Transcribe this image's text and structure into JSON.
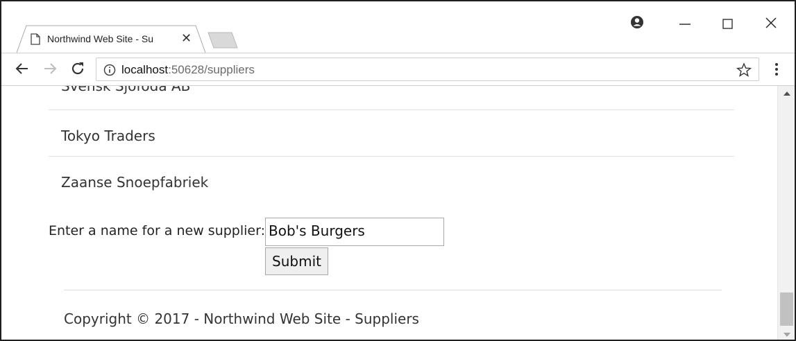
{
  "browser": {
    "tab": {
      "title": "Northwind Web Site - Su",
      "close_glyph": "✕",
      "page_icon": "page-icon"
    },
    "window_controls": {
      "minimize_glyph": "—",
      "maximize_glyph": "☐",
      "close_glyph": "✕"
    },
    "address_bar": {
      "host": "localhost",
      "rest": ":50628/suppliers"
    },
    "icons": [
      "back-arrow-icon",
      "forward-arrow-icon",
      "reload-icon",
      "info-icon",
      "star-icon",
      "menu-icon",
      "profile-icon"
    ]
  },
  "page": {
    "suppliers": [
      "Svensk Sjöföda AB",
      "Tokyo Traders",
      "Zaanse Snoepfabriek"
    ],
    "form": {
      "label": "Enter a name for a new supplier:",
      "input_value": "Bob's Burgers",
      "submit_label": "Submit"
    },
    "footer": "Copyright © 2017 - Northwind Web Site - Suppliers"
  },
  "colors": {
    "frame": "#1f1f1f",
    "divider": "#e2e2e2",
    "scroll_thumb": "#c1c1c1"
  }
}
